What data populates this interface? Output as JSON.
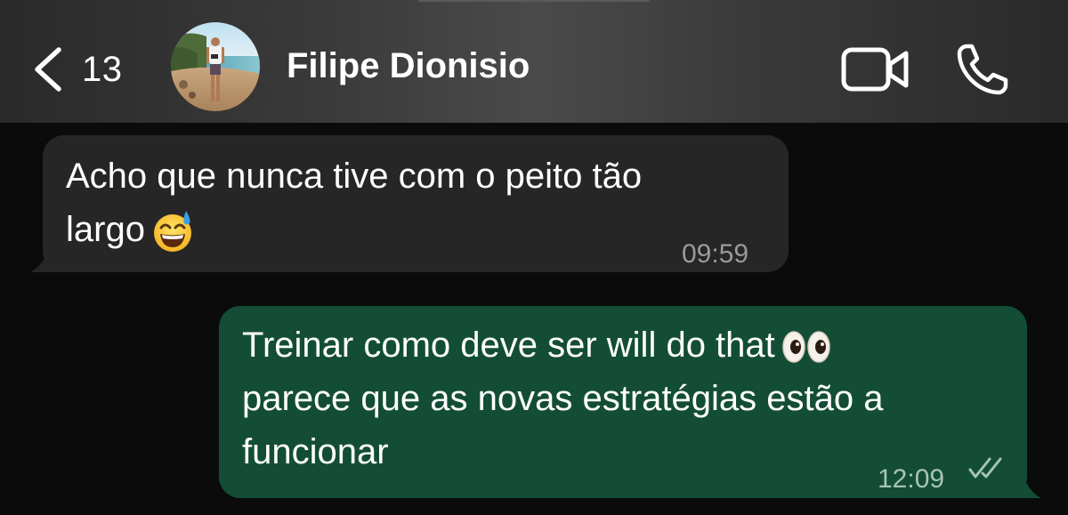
{
  "header": {
    "back_count": "13",
    "contact_name": "Filipe Dionisio"
  },
  "messages": [
    {
      "direction": "incoming",
      "lines": [
        "Acho que nunca tive com o peito tão",
        "largo"
      ],
      "emoji": "grinning-face-with-sweat",
      "time": "09:59"
    },
    {
      "direction": "outgoing",
      "lines": [
        "Treinar como deve ser will do that",
        "parece que as novas estratégias estão a",
        "funcionar"
      ],
      "emoji": "eyes",
      "time": "12:09",
      "status": "read"
    }
  ],
  "colors": {
    "background": "#0b0b0b",
    "incoming_bubble": "#262626",
    "outgoing_bubble": "#134d35"
  }
}
